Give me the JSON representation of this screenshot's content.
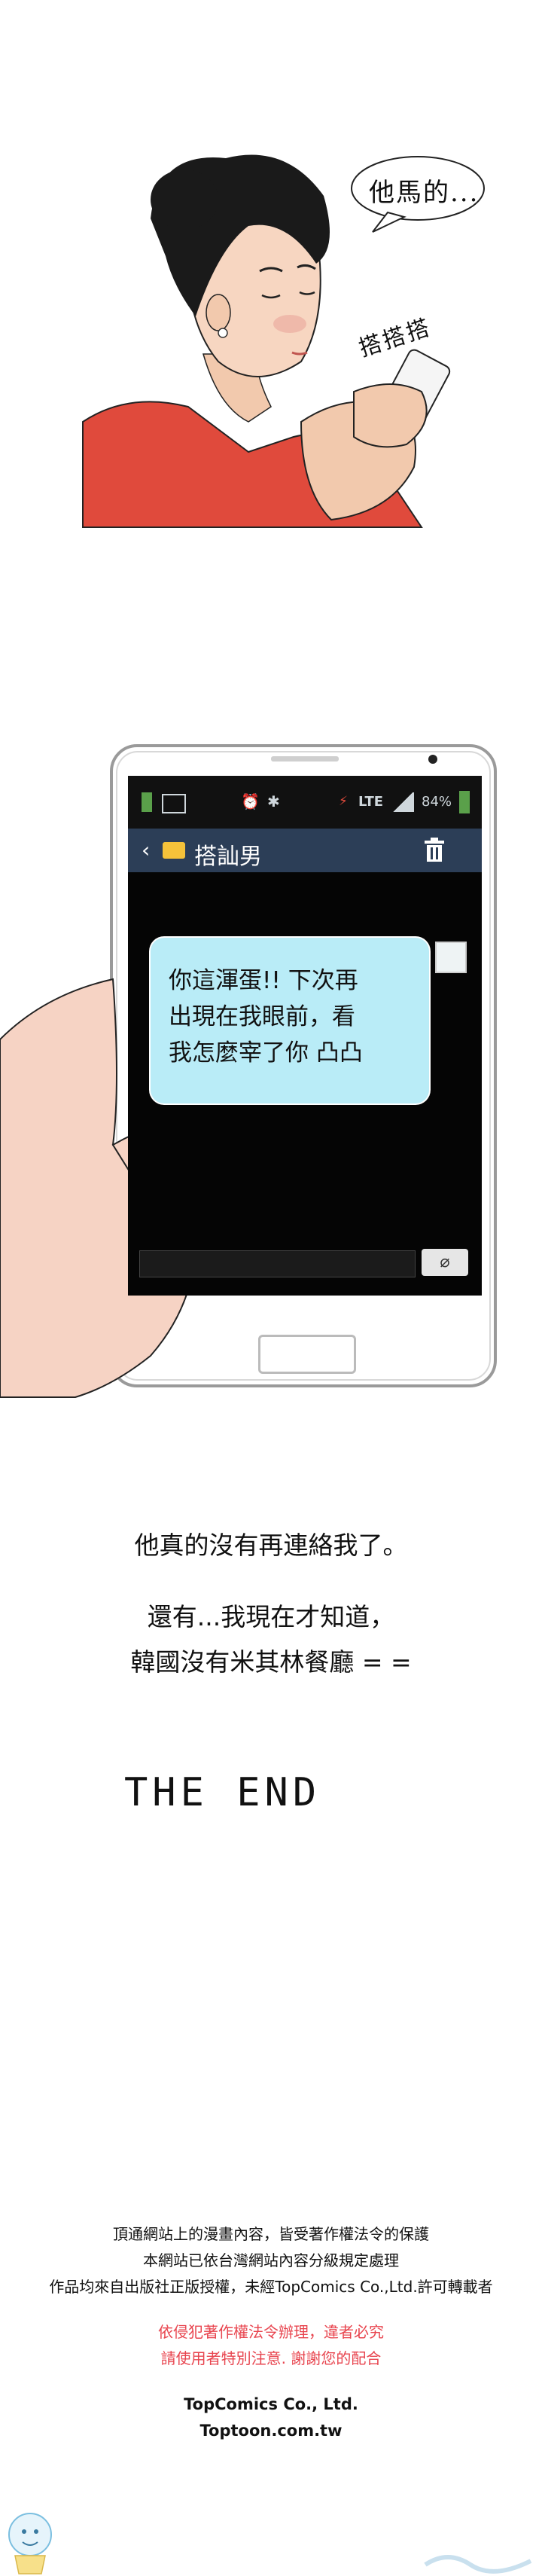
{
  "panel1": {
    "speech": "他馬的...",
    "sfx": "搭搭搭"
  },
  "phone": {
    "status_battery": "84%",
    "status_network": "LTE",
    "chat_title": "搭訕男",
    "back_glyph": "‹",
    "message_lines": [
      "你這渾蛋!! 下次再",
      "出現在我眼前，看",
      "我怎麼宰了你 凸凸"
    ],
    "attach_glyph": "⌀"
  },
  "narration": {
    "line1": "他真的沒有再連絡我了。",
    "line2": "還有...我現在才知道，",
    "line3": "韓國沒有米其林餐廳 = ="
  },
  "the_end": "THE  END",
  "footer": {
    "notice_lines": [
      "頂通網站上的漫畫內容，皆受著作權法令的保護",
      "本網站已依台灣網站內容分級規定處理",
      "作品均來自出版社正版授權，未經TopComics Co.,Ltd.許可轉載者"
    ],
    "warning_lines": [
      "依侵犯著作權法令辦理，違者必究",
      "請使用者特別注意. 謝謝您的配合"
    ],
    "company": "TopComics Co., Ltd.",
    "site": "Toptoon.com.tw"
  },
  "colors": {
    "skin": "#f2c9ad",
    "hair": "#1a1a1a",
    "shirt": "#e04a3c",
    "bubble": "#b9ecf7",
    "header": "#2c3e57",
    "warning": "#e8454f"
  }
}
